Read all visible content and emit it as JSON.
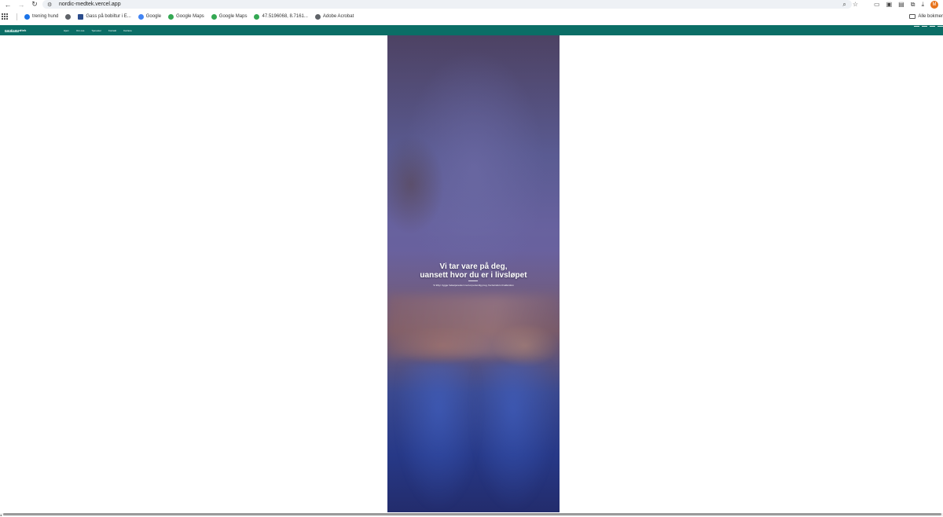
{
  "browser": {
    "url": "nordic-medtek.vercel.app",
    "avatar_letter": "M",
    "icons": [
      "back-icon",
      "forward-icon",
      "reload-icon",
      "site-settings-icon",
      "zoom-icon",
      "star-icon",
      "cast-icon",
      "extension-icon",
      "puzzle-icon",
      "download-icon"
    ]
  },
  "bookmarks": {
    "items": [
      {
        "label": "trening hund",
        "color": "#1a73e8"
      },
      {
        "label": "",
        "color": "#5f6368"
      },
      {
        "label": "Gass på bobiltur i E...",
        "color": "#2b4c8c"
      },
      {
        "label": "Google",
        "color": "#4285f4"
      },
      {
        "label": "Google Maps",
        "color": "#34a853"
      },
      {
        "label": "Google Maps",
        "color": "#34a853"
      },
      {
        "label": "47.5196068, 8.7161...",
        "color": "#34a853"
      },
      {
        "label": "Adobe Acrobat",
        "color": "#5f6368"
      }
    ],
    "all_label": "Alle bokmer"
  },
  "site": {
    "accent": "#0b6e66",
    "logo": "nordicmedtek",
    "nav": [
      "Hjem",
      "Om oss",
      "Tjenester",
      "Kontakt",
      "Karriere"
    ]
  },
  "hero": {
    "title_line1": "Vi tar vare på deg,",
    "title_line2": "uansett hvor du er i livsløpet",
    "subtitle": "Vi tilbyr trygge helsetjenester med et personlig preg, fra barndom til alderdom"
  }
}
